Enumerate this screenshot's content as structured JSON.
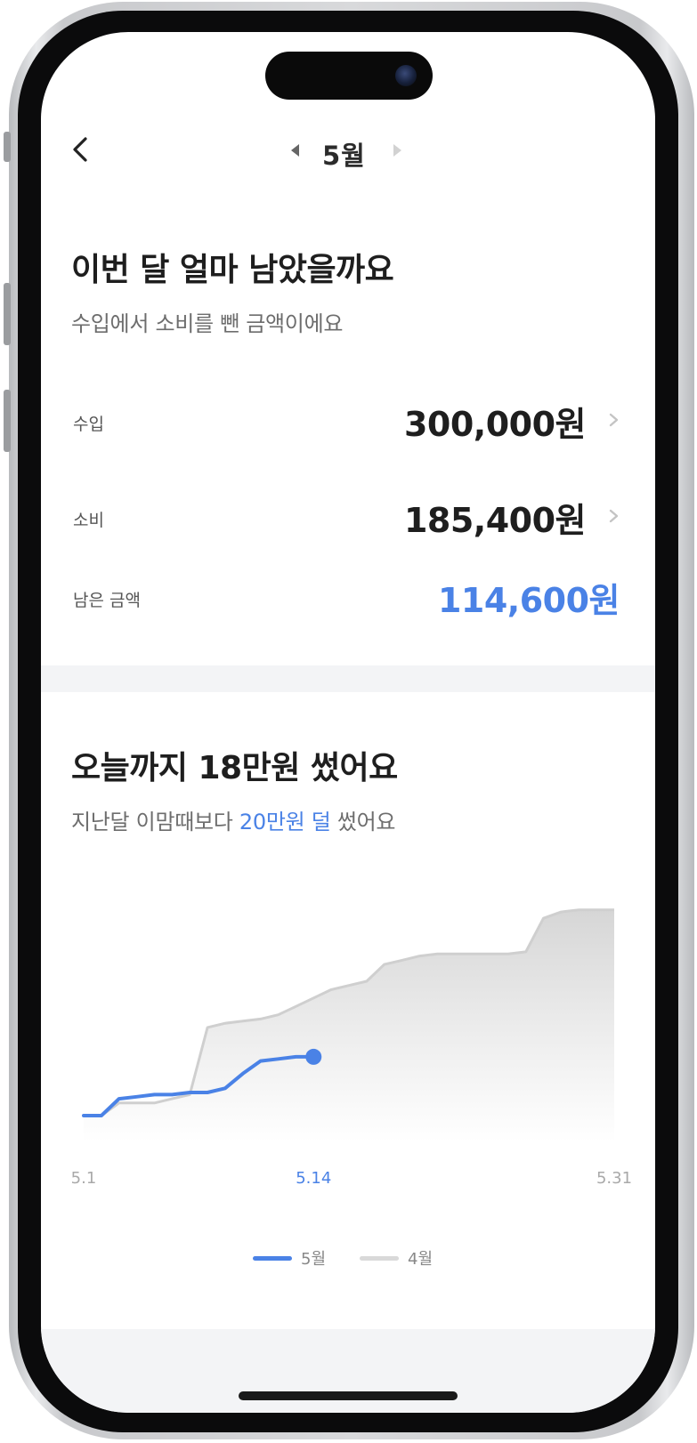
{
  "header": {
    "month_label": "5월"
  },
  "remaining": {
    "title": "이번 달 얼마 남았을까요",
    "subtitle": "수입에서 소비를 뺀 금액이에요",
    "rows": [
      {
        "label": "수입",
        "amount": "300,000원"
      },
      {
        "label": "소비",
        "amount": "185,400원"
      },
      {
        "label": "남은 금액",
        "amount": "114,600원"
      }
    ]
  },
  "spending": {
    "title": "오늘까지 18만원 썼어요",
    "subtitle_prefix": "지난달 이맘때보다 ",
    "subtitle_highlight": "20만원 덜",
    "subtitle_suffix": " 썼어요"
  },
  "chart_data": {
    "type": "line",
    "x_ticks": [
      "5.1",
      "5.14",
      "5.31"
    ],
    "x_domain": [
      1,
      31
    ],
    "series": [
      {
        "name": "5월",
        "color": "#4a82e6",
        "x": [
          1,
          2,
          3,
          4,
          5,
          6,
          7,
          8,
          9,
          10,
          11,
          12,
          13,
          14
        ],
        "y": [
          0,
          0,
          0.08,
          0.09,
          0.1,
          0.1,
          0.11,
          0.11,
          0.13,
          0.2,
          0.26,
          0.27,
          0.28,
          0.28
        ]
      },
      {
        "name": "4월",
        "color": "#d9d9d9",
        "x": [
          1,
          2,
          3,
          4,
          5,
          6,
          7,
          8,
          9,
          10,
          11,
          12,
          13,
          14,
          15,
          16,
          17,
          18,
          19,
          20,
          21,
          22,
          23,
          24,
          25,
          26,
          27,
          28,
          29,
          30,
          31
        ],
        "y": [
          0,
          0,
          0.06,
          0.06,
          0.06,
          0.08,
          0.1,
          0.42,
          0.44,
          0.45,
          0.46,
          0.48,
          0.52,
          0.56,
          0.6,
          0.62,
          0.64,
          0.72,
          0.74,
          0.76,
          0.77,
          0.77,
          0.77,
          0.77,
          0.77,
          0.78,
          0.94,
          0.97,
          0.98,
          0.98,
          0.98
        ]
      }
    ],
    "current_x": 14,
    "grid": false,
    "legend_position": "bottom"
  },
  "legend": {
    "items": [
      {
        "label": "5월",
        "color": "#4a82e6"
      },
      {
        "label": "4월",
        "color": "#d9d9d9"
      }
    ]
  }
}
